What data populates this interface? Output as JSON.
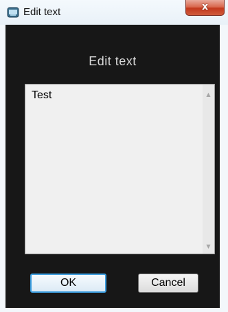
{
  "window": {
    "title": "Edit text",
    "close_symbol": "x",
    "app_icon": "dialog-icon"
  },
  "dialog": {
    "heading": "Edit text",
    "text_value": "Test",
    "scroll_up_symbol": "▲",
    "scroll_down_symbol": "▼"
  },
  "buttons": {
    "ok_label": "OK",
    "cancel_label": "Cancel"
  },
  "colors": {
    "client_background": "#171717",
    "heading_text": "#dadada",
    "close_button": "#c3391d",
    "ok_border": "#3c9ee0"
  }
}
